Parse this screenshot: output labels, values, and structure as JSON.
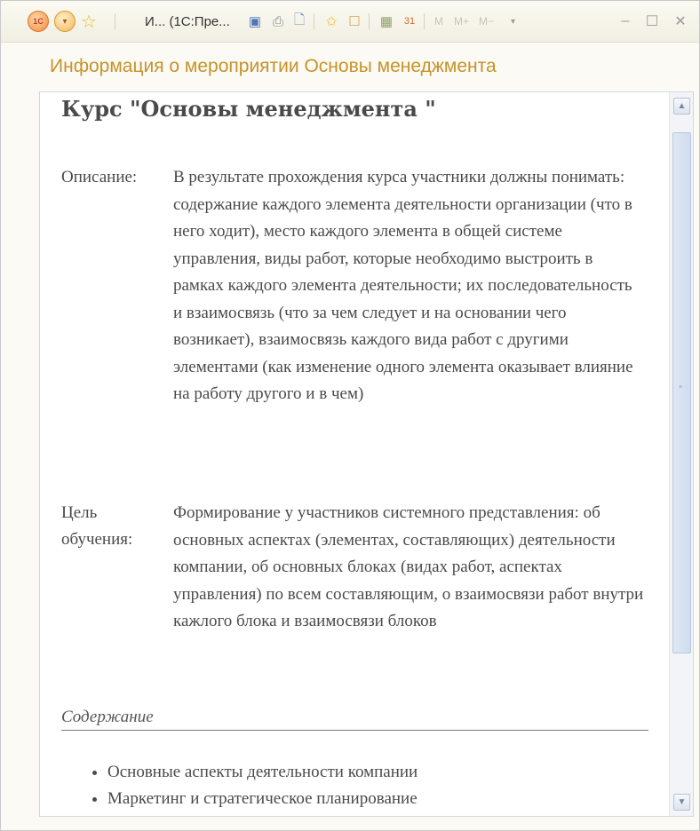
{
  "titlebar": {
    "app_icon": "1C",
    "title": "И... (1С:Пре...",
    "buttons": {
      "m": "M",
      "mplus": "M+",
      "mminus": "M−"
    }
  },
  "header": {
    "title": "Информация о мероприятии Основы менеджмента"
  },
  "course": {
    "title": "Курс \"Основы менеджмента \"",
    "description_label": "Описание:",
    "description": "В результате прохождения курса участники должны понимать: содержание каждого элемента деятельности организации (что в него ходит), место каждого элемента в общей системе управления, виды работ, которые необходимо выстроить в рамках каждого элемента деятельности; их последовательность и взаимосвязь (что за чем следует и на основании чего возникает), взаимосвязь каждого вида работ с другими элементами (как изменение одного элемента оказывает влияние на работу другого и в чем)",
    "goal_label_line1": "Цель",
    "goal_label_line2": "обучения:",
    "goal": "Формирование у участников системного представления: об основных аспектах (элементах, составляющих) деятельности компании, об основных блоках (видах работ, аспектах управления) по всем составляющим, о взаимосвязи работ внутри кажлого блока и взаимосвязи блоков",
    "content_heading": "Содержание",
    "content_items": [
      "Основные аспекты деятельности компании",
      "Маркетинг и стратегическое планирование"
    ]
  },
  "colors": {
    "header_title": "#c7932a",
    "text": "#4a4a4a"
  }
}
